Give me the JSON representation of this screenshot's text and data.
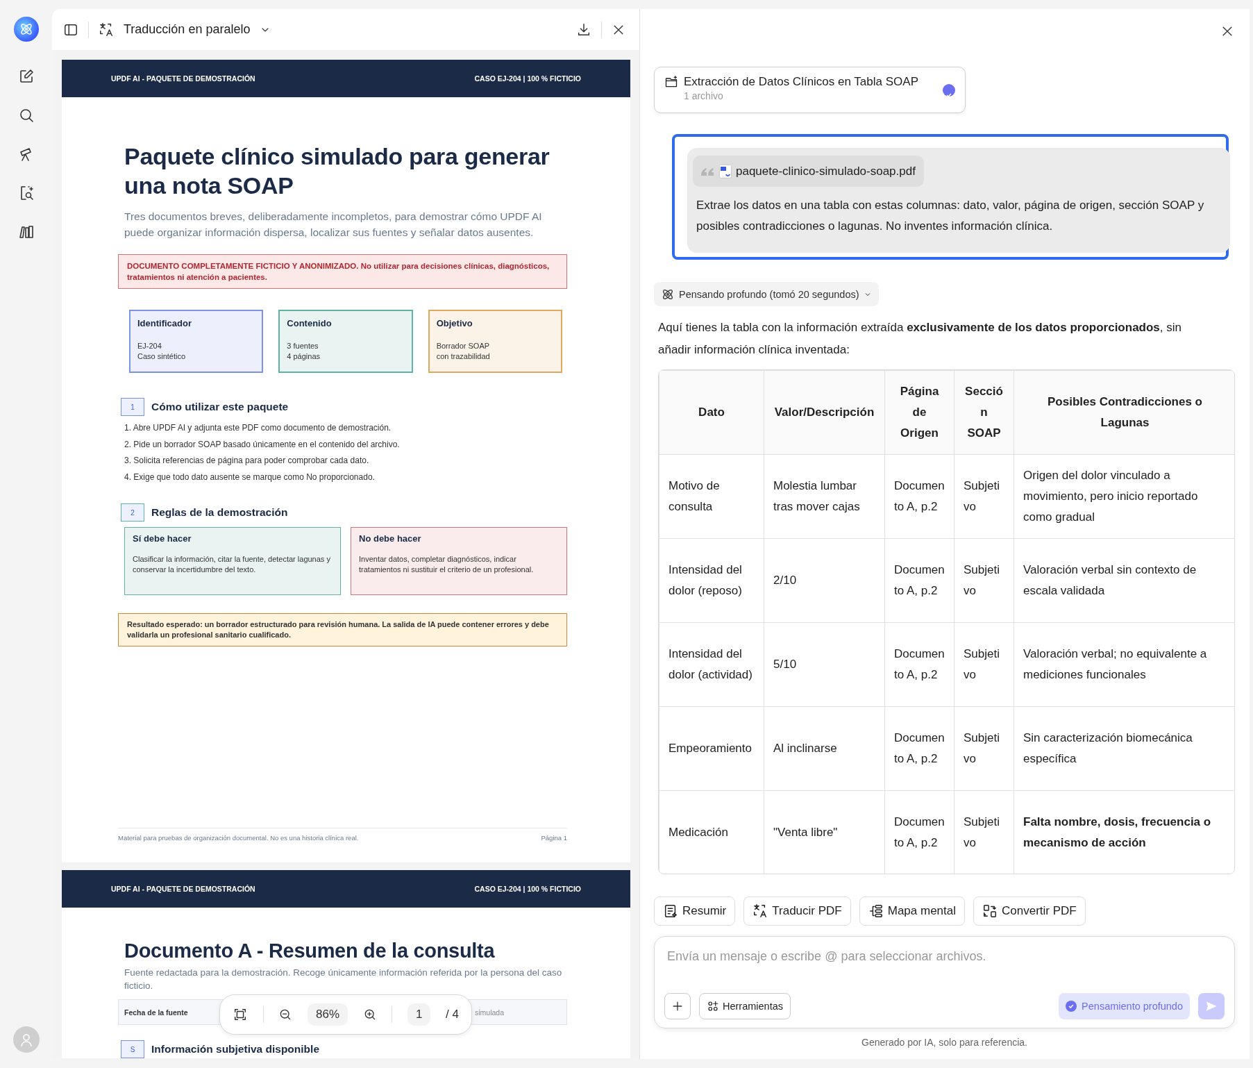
{
  "left_panel": {
    "title": "Traducción en paralelo",
    "pages": [
      {
        "kind": "cover",
        "header_left": "UPDF AI - PAQUETE DE DEMOSTRACIÓN",
        "header_right": "CASO EJ-204 | 100 % FICTICIO",
        "title": "Paquete clínico simulado para generar una nota SOAP",
        "subtitle": "Tres documentos breves, deliberadamente incompletos, para demostrar cómo UPDF AI puede organizar información dispersa, localizar sus fuentes y señalar datos ausentes.",
        "warning": "DOCUMENTO COMPLETAMENTE FICTICIO Y ANONIMIZADO. No utilizar para decisiones clínicas, diagnósticos, tratamientos ni atención a pacientes.",
        "cards": [
          {
            "title": "Identificador",
            "lines": [
              "EJ-204",
              "Caso sintético"
            ],
            "color": "#7b93e6"
          },
          {
            "title": "Contenido",
            "lines": [
              "3 fuentes",
              "4 páginas"
            ],
            "color": "#5fb3a5"
          },
          {
            "title": "Objetivo",
            "lines": [
              "Borrador SOAP",
              "con trazabilidad"
            ],
            "color": "#e0a85c"
          }
        ],
        "sections": [
          {
            "kind": "steps",
            "number": "1",
            "title": "Cómo utilizar este paquete",
            "color": "#7b93e6",
            "steps": [
              "1. Abre UPDF AI y adjunta este PDF como documento de demostración.",
              "2. Pide un borrador SOAP basado únicamente en el contenido del archivo.",
              "3. Solicita referencias de página para poder comprobar cada dato.",
              "4. Exige que todo dato ausente se marque como No proporcionado."
            ]
          },
          {
            "kind": "rules",
            "number": "2",
            "title": "Reglas de la demostración",
            "color": "#5fb3a5",
            "rules": [
              {
                "title": "Sí debe hacer",
                "text": "Clasificar la información, citar la fuente, detectar lagunas y conservar la incertidumbre del texto.",
                "color": "#5fb3a5"
              },
              {
                "title": "No debe hacer",
                "text": "Inventar datos, completar diagnósticos, indicar tratamientos ni sustituir el criterio de un profesional.",
                "color": "#d8737a"
              }
            ]
          }
        ],
        "note": "Resultado esperado: un borrador estructurado para revisión humana. La salida de IA puede contener errores y debe validarla un profesional sanitario cualificado.",
        "footer_left": "Material para pruebas de organización documental. No es una historia clínica real.",
        "footer_right": "Página 1"
      },
      {
        "kind": "document",
        "header_left": "UPDF AI - PAQUETE DE DEMOSTRACIÓN",
        "header_right": "CASO EJ-204 | 100 % FICTICIO",
        "title": "Documento A - Resumen de la consulta",
        "subtitle": "Fuente redactada para la demostración. Recoge únicamente información referida por la persona del caso ficticio.",
        "field_row": {
          "label": "Fecha de la fuente",
          "column_2": "simulada"
        },
        "sections": [
          {
            "kind": "heading",
            "number": "S",
            "title": "Información subjetiva disponible",
            "color": "#7b93e6"
          }
        ]
      }
    ],
    "zoom_bar": {
      "zoom": "86%",
      "page": "1",
      "total": "/ 4"
    }
  },
  "ai_panel": {
    "task_card": {
      "title": "Extracción de Datos Clínicos en Tabla SOAP",
      "subtitle": "1 archivo",
      "done": true
    },
    "prompt": {
      "file": "paquete-clinico-simulado-soap.pdf",
      "text": "Extrae los datos en una tabla con estas columnas: dato, valor, página de origen, sección SOAP y posibles contradicciones o lagunas. No inventes información clínica.",
      "selected": true
    },
    "thinking": {
      "label": "Pensando profundo (tomó 20 segundos)",
      "expanded": false
    },
    "intro": "Aquí tienes la tabla con la información extraída **exclusivamente de los datos proporcionados**, sin añadir información clínica inventada:",
    "table": {
      "columns": [
        "Dato",
        "Valor/Descripción",
        "Página de Origen",
        "Sección SOAP",
        "Posibles Contradicciones o Lagunas"
      ],
      "rows": [
        {
          "cells": [
            "Motivo de consulta",
            "Molestia lumbar tras mover cajas",
            "Documento A, p.2",
            "Subjetivo",
            "Origen del dolor vinculado a movimiento, pero inicio reportado como gradual"
          ],
          "emphasis": false
        },
        {
          "cells": [
            "Intensidad del dolor (reposo)",
            "2/10",
            "Documento A, p.2",
            "Subjetivo",
            "Valoración verbal sin contexto de escala validada"
          ],
          "emphasis": false
        },
        {
          "cells": [
            "Intensidad del dolor (actividad)",
            "5/10",
            "Documento A, p.2",
            "Subjetivo",
            "Valoración verbal; no equivalente a mediciones funcionales"
          ],
          "emphasis": false
        },
        {
          "cells": [
            "Empeoramiento",
            "Al inclinarse",
            "Documento A, p.2",
            "Subjetivo",
            "Sin caracterización biomecánica específica"
          ],
          "emphasis": false
        },
        {
          "cells": [
            "Medicación",
            "\"Venta libre\"",
            "Documento A, p.2",
            "Subjetivo",
            "Falta nombre, dosis, frecuencia o mecanismo de acción"
          ],
          "emphasis": true
        }
      ]
    },
    "actions": [
      {
        "kind": "summary",
        "label": "Resumir"
      },
      {
        "kind": "translate",
        "label": "Traducir PDF"
      },
      {
        "kind": "mindmap",
        "label": "Mapa mental"
      },
      {
        "kind": "convert",
        "label": "Convertir PDF"
      }
    ],
    "composer": {
      "placeholder": "Envía un mensaje o escribe @ para seleccionar archivos.",
      "tools": "Herramientas",
      "deep_thinking": {
        "label": "Pensamiento profundo",
        "on": true
      }
    },
    "footer": "Generado por IA, solo para referencia."
  }
}
